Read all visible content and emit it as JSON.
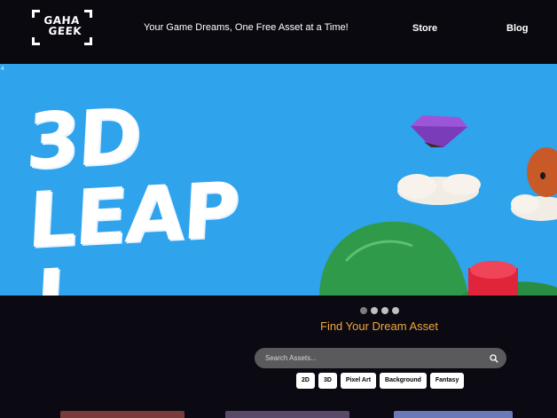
{
  "header": {
    "logo_alt": "GAHA GEEK",
    "logo_line1": "GAHA",
    "logo_line2": "GEEK",
    "tagline": "Your Game Dreams, One Free Asset at a Time!",
    "nav": {
      "store": "Store",
      "blog": "Blog"
    }
  },
  "hero": {
    "corner_mark": "4",
    "headline_line1": "3D",
    "headline_line2": "LEAP",
    "headline_line3": "L",
    "bg_color": "#2fa3ec",
    "slide_count": 4,
    "active_slide": 1
  },
  "search": {
    "title": "Find Your Dream Asset",
    "placeholder": "Search Assets...",
    "icon": "search-icon"
  },
  "tags": [
    "2D",
    "3D",
    "Pixel Art",
    "Background",
    "Fantasy"
  ],
  "colors": {
    "accent": "#f0a63c",
    "background": "#0b0a12",
    "search_bg": "#5a5a5d"
  }
}
